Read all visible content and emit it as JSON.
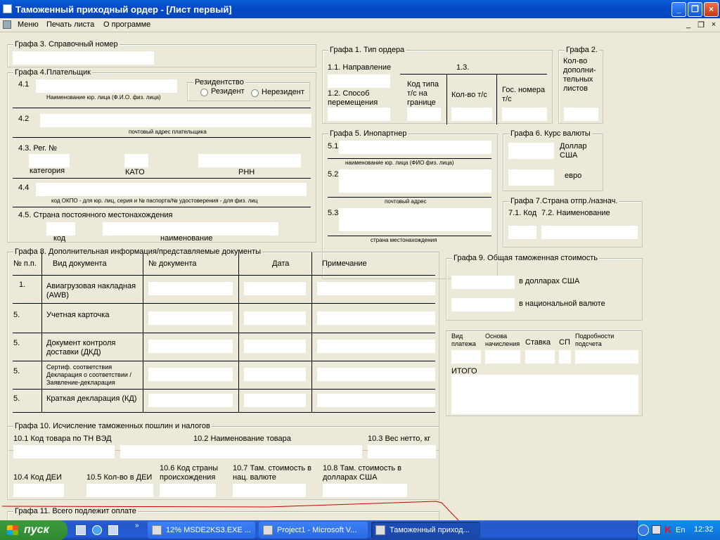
{
  "window": {
    "title": "Таможенный приходный ордер - [Лист первый]"
  },
  "menu": {
    "items": [
      "Меню",
      "Печать листа",
      "О программе"
    ],
    "mdi_min": "_",
    "mdi_restore": "❐",
    "mdi_close": "×"
  },
  "titlebtns": {
    "min": "_",
    "max": "❐",
    "close": "×"
  },
  "g3": {
    "legend": "Графа 3. Справочный номер"
  },
  "g4": {
    "legend": "Графа 4.Плательщик",
    "l41": "4.1",
    "h41": "Наименование юр. лица (Ф.И.О. физ. лица)",
    "res_legend": "Резидентство",
    "resident": "Резидент",
    "nonresident": "Нерезидент",
    "l42": "4.2",
    "h42": "почтовый адрес плательщика",
    "l43": "4.3. Рег. №",
    "cat": "категория",
    "kato": "КАТО",
    "rnn": "РНН",
    "l44": "4.4",
    "h44": "код ОКПО - для юр. лиц, серия и № паспорта/№ удостоверения - для физ. лиц",
    "l45": "4.5. Страна постоянного местонахождения",
    "kod": "код",
    "name": "наименование"
  },
  "g1": {
    "legend": "Графа 1. Тип ордера",
    "l11": "1.1. Направление",
    "l13": "1.3.",
    "l12": "1.2. Способ перемещения",
    "code": "Код типа т/с на границе",
    "qty": "Кол-во т/с",
    "gos": "Гос. номера т/с"
  },
  "g2": {
    "legend": "Графа 2.",
    "sub": "Кол-во дополни-тельных листов"
  },
  "g5": {
    "legend": "Графа 5. Инопартнер",
    "l51": "5.1",
    "h51": "наименование юр. лица (ФИО физ. лица)",
    "l52": "5.2",
    "h52": "почтовый адрес",
    "l53": "5.3",
    "h53": "страна местонахождения"
  },
  "g6": {
    "legend": "Графа 6. Курс валюты",
    "usd": "Доллар США",
    "eur": "евро"
  },
  "g7": {
    "legend": "Графа 7.Страна отпр./назнач.",
    "l71": "7.1. Код",
    "l72": "7.2. Наименование"
  },
  "g8": {
    "legend": "Графа 8. Дополнительная информация/представляемые документы",
    "headers": [
      "№ п.п.",
      "Вид документа",
      "№ документа",
      "Дата",
      "Примечание"
    ],
    "rows": [
      {
        "n": "1.",
        "doc": "Авиагрузовая накладная (AWB)"
      },
      {
        "n": "5.",
        "doc": "Учетная карточка"
      },
      {
        "n": "5.",
        "doc": "Документ контроля доставки (ДКД)"
      },
      {
        "n": "5.",
        "doc": "Сертиф. соответствия Декларация о соответствии /Заявление-декларация"
      },
      {
        "n": "5.",
        "doc": "Краткая декларация (КД)"
      }
    ]
  },
  "g9": {
    "legend": "Графа 9. Общая таможенная стоимость",
    "usd": "в долларах США",
    "nat": "в национальной валюте"
  },
  "pay": {
    "vid": "Вид платежа",
    "osnova": "Основа начисления",
    "stavka": "Ставка",
    "sp": "СП",
    "podr": "Подробности подсчета",
    "itogo": "ИТОГО"
  },
  "g10": {
    "legend": "Графа 10. Исчисление таможенных пошлин и налогов",
    "l101": "10.1 Код товара по ТН ВЭД",
    "l102": "10.2 Наименование товара",
    "l103": "10.3 Вес нетто, кг",
    "l104": "10.4 Код ДЕИ",
    "l105": "10.5 Кол-во в ДЕИ",
    "l106": "10.6 Код страны происхождения",
    "l107": "10.7 Там. стоимость в нац. валюте",
    "l108": "10.8 Там. стоимость в долларах США"
  },
  "g11": {
    "legend": "Графа 11. Всего подлежит оплате"
  },
  "taskbar": {
    "start": "пуск",
    "tasks": [
      "12% MSDE2KS3.EXE ...",
      "Project1 - Microsoft V...",
      "Таможенный приход..."
    ],
    "lang": "En",
    "clock": "12:32"
  },
  "colors": {
    "title": "#0a5fd8",
    "taskbar": "#245dd8",
    "start": "#3c9a3c",
    "annotation_line": "#cc0000"
  }
}
